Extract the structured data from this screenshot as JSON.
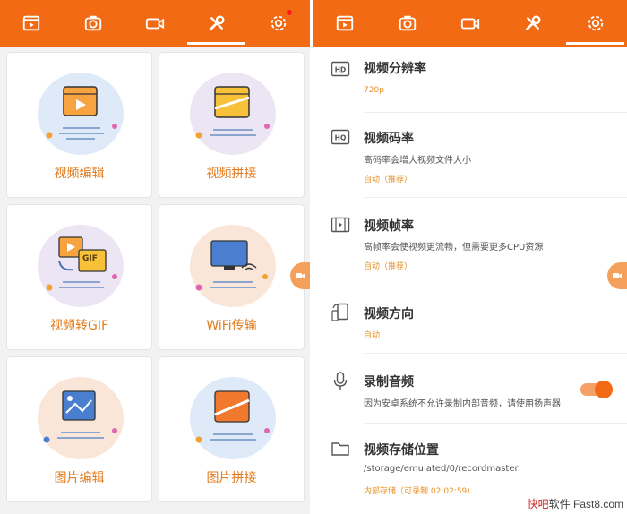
{
  "left": {
    "tabs": [
      {
        "icon": "video-clip-icon"
      },
      {
        "icon": "camera-icon"
      },
      {
        "icon": "video-recorder-icon"
      },
      {
        "icon": "tools-icon",
        "active": true
      },
      {
        "icon": "settings-icon",
        "badge": true
      }
    ],
    "cards": [
      {
        "label": "视频编辑",
        "blob": "#dfeaf8"
      },
      {
        "label": "视频拼接",
        "blob": "#ece6f4"
      },
      {
        "label": "视频转GIF",
        "blob": "#ece6f4"
      },
      {
        "label": "WiFi传输",
        "blob": "#f9e6d8"
      },
      {
        "label": "图片编辑",
        "blob": "#f9e6d8"
      },
      {
        "label": "图片拼接",
        "blob": "#dfeaf8"
      }
    ],
    "gif_badge": "GIF"
  },
  "right": {
    "settings": [
      {
        "icon": "hd-icon",
        "icon_text": "HD",
        "title": "视频分辨率",
        "desc": "",
        "value": "720p"
      },
      {
        "icon": "hq-icon",
        "icon_text": "HQ",
        "title": "视频码率",
        "desc": "高码率会增大视频文件大小",
        "value": "自动（推荐）"
      },
      {
        "icon": "film-frame-icon",
        "title": "视频帧率",
        "desc": "高帧率会使视频更流畅，但需要更多CPU资源",
        "value": "自动（推荐）"
      },
      {
        "icon": "screen-rotation-icon",
        "title": "视频方向",
        "desc": "",
        "value": "自动"
      },
      {
        "icon": "microphone-icon",
        "title": "录制音频",
        "desc": "因为安卓系统不允许录制内部音频，请使用扬声器",
        "value": "",
        "toggle_on": true
      },
      {
        "icon": "folder-icon",
        "title": "视频存储位置",
        "desc": "/storage/emulated/0/recordmaster",
        "value": "内部存储（可录制 02:02:59）"
      }
    ]
  },
  "watermark": {
    "brand": "快吧",
    "middle": "软件",
    "site": "Fast8.com"
  },
  "colors": {
    "accent": "#f26b14",
    "label": "#e37b1e",
    "value": "#e8922a"
  }
}
